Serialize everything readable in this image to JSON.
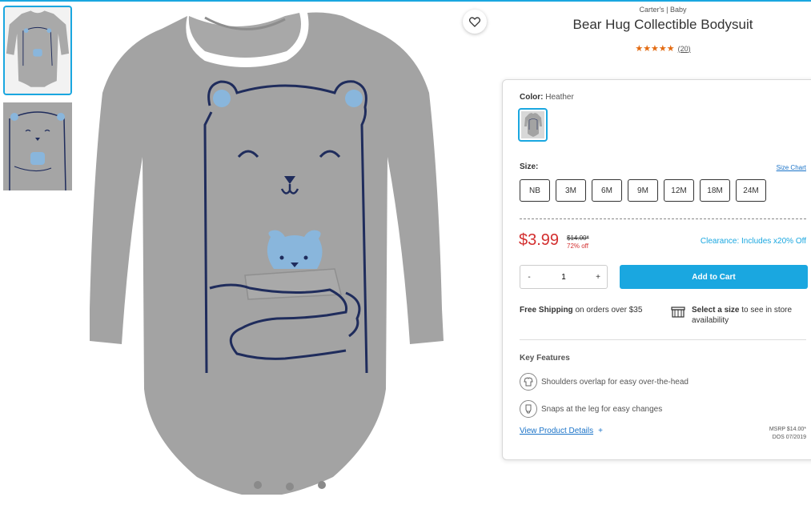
{
  "product": {
    "brand": "Carter's | Baby",
    "title": "Bear Hug Collectible Bodysuit",
    "stars": "★★★★★",
    "review_count": "(20)"
  },
  "color": {
    "label": "Color:",
    "value": "Heather"
  },
  "size": {
    "label": "Size:",
    "chart_link": "Size Chart",
    "options": [
      "NB",
      "3M",
      "6M",
      "9M",
      "12M",
      "18M",
      "24M"
    ]
  },
  "pricing": {
    "price": "$3.99",
    "original_price": "$14.00*",
    "discount": "72% off",
    "clearance": "Clearance: Includes x20% Off"
  },
  "cart": {
    "qty_minus": "-",
    "qty_value": "1",
    "qty_plus": "+",
    "add_label": "Add to Cart"
  },
  "shipping": {
    "bold": "Free Shipping",
    "text": " on orders over $35"
  },
  "store": {
    "bold": "Select a size",
    "text": " to see in store availability"
  },
  "features": {
    "title": "Key Features",
    "items": [
      "Shoulders overlap for easy over-the-head",
      "Snaps at the leg for easy changes"
    ]
  },
  "details": {
    "link": "View Product Details",
    "plus": "+",
    "msrp": "MSRP $14.00*",
    "dos": "DOS 07/2019"
  },
  "colors": {
    "accent": "#1aa7e0",
    "price_red": "#d32f2f",
    "star_orange": "#e36b12"
  }
}
